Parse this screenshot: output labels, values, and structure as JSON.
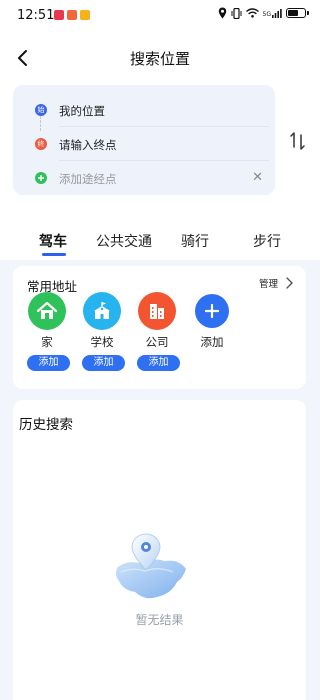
{
  "status_bar": {
    "time": "12:51",
    "signal": "5G"
  },
  "header": {
    "title": "搜索位置"
  },
  "route": {
    "start_badge": "始",
    "start": "我的位置",
    "end_badge": "终",
    "end_placeholder": "请输入终点",
    "via_placeholder": "添加途经点",
    "clear": "✕"
  },
  "tabs": [
    {
      "label": "驾车",
      "active": true
    },
    {
      "label": "公共交通",
      "active": false
    },
    {
      "label": "骑行",
      "active": false
    },
    {
      "label": "步行",
      "active": false
    }
  ],
  "common_addresses": {
    "title": "常用地址",
    "manage": "管理",
    "items": [
      {
        "name": "家",
        "icon": "home-icon",
        "color": "#2fc15a",
        "action": "添加"
      },
      {
        "name": "学校",
        "icon": "school-icon",
        "color": "#27b3ee",
        "action": "添加"
      },
      {
        "name": "公司",
        "icon": "office-building-icon",
        "color": "#f2552f",
        "action": "添加"
      },
      {
        "name": "添加",
        "icon": "plus-icon",
        "color": "#2f6ff2"
      }
    ]
  },
  "history": {
    "title": "历史搜索",
    "empty_text": "暂无结果"
  },
  "colors": {
    "accent": "#2f61f0",
    "page_bg": "#f2f5fb"
  }
}
